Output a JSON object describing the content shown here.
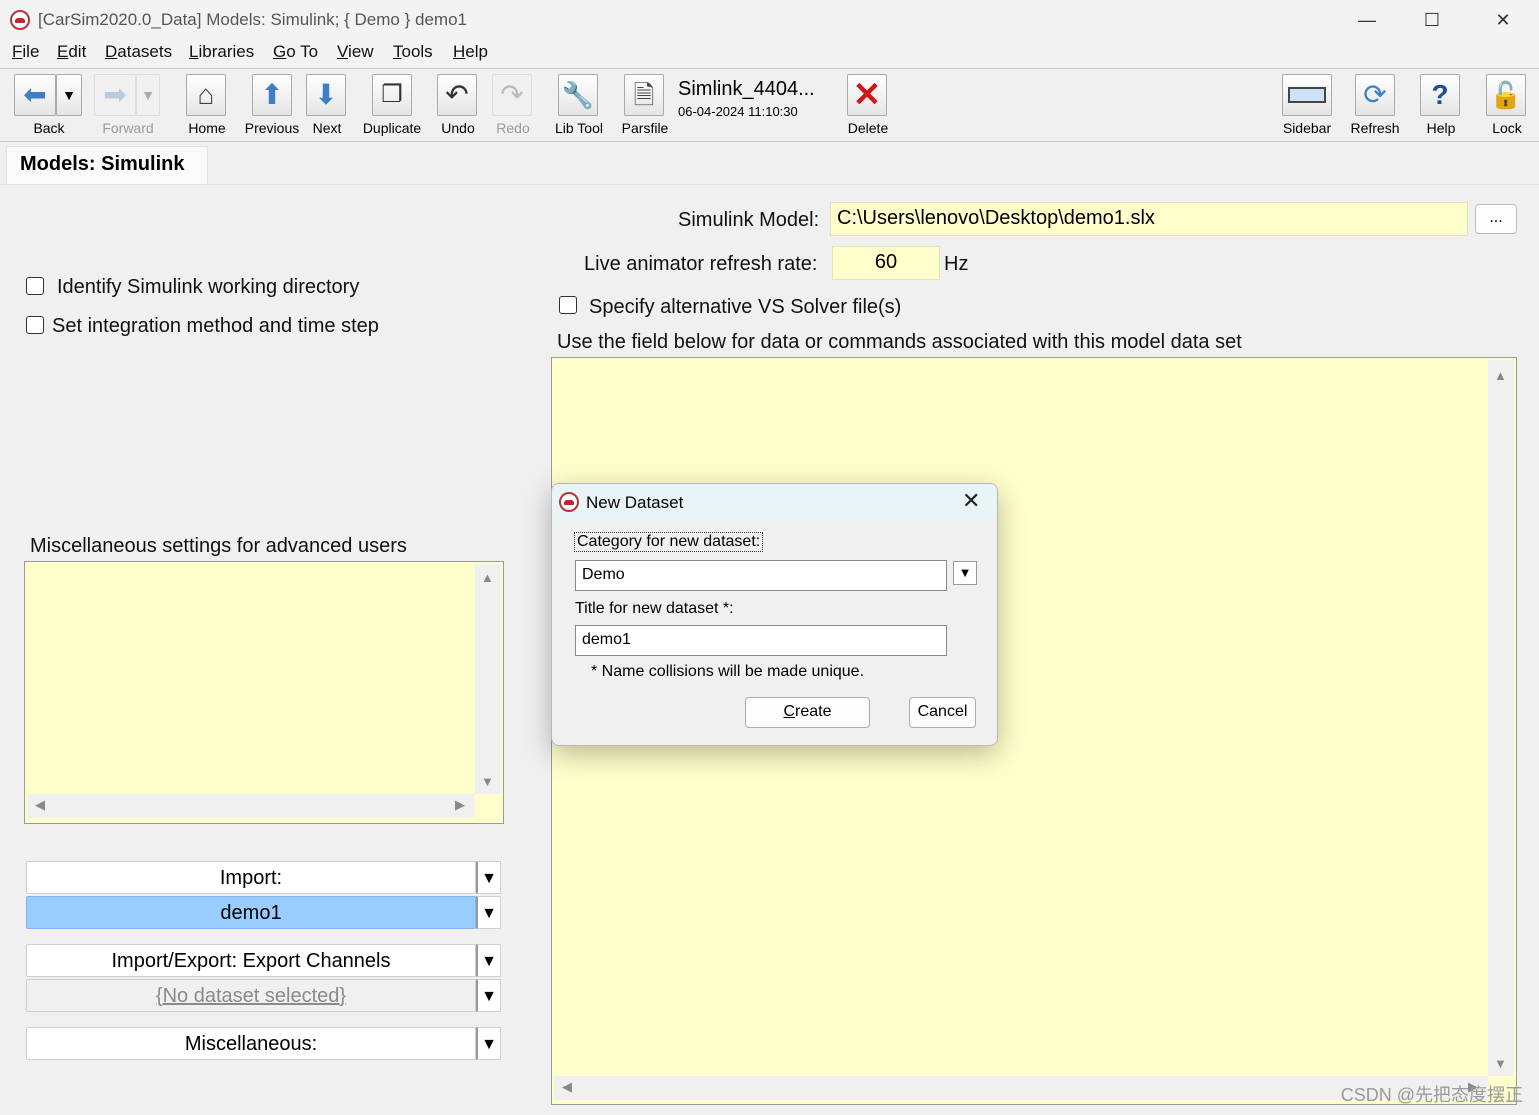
{
  "window": {
    "title": "[CarSim2020.0_Data] Models: Simulink; { Demo } demo1",
    "minimize_glyph": "—",
    "maximize_glyph": "☐",
    "close_glyph": "✕"
  },
  "menu": [
    {
      "key": "F",
      "rest": "ile"
    },
    {
      "key": "E",
      "rest": "dit"
    },
    {
      "key": "D",
      "rest": "atasets"
    },
    {
      "key": "L",
      "rest": "ibraries"
    },
    {
      "key": "G",
      "rest": "o To"
    },
    {
      "key": "V",
      "rest": "iew"
    },
    {
      "key": "T",
      "rest": "ools"
    },
    {
      "key": "H",
      "rest": "elp"
    }
  ],
  "toolbar": {
    "back": "Back",
    "forward": "Forward",
    "home": "Home",
    "previous": "Previous",
    "next": "Next",
    "duplicate": "Duplicate",
    "undo": "Undo",
    "redo": "Redo",
    "lib_tool": "Lib Tool",
    "parsfile": "Parsfile",
    "parsfile_title": "Simlink_4404...",
    "parsfile_date": "06-04-2024 11:10:30",
    "delete": "Delete",
    "sidebar": "Sidebar",
    "refresh": "Refresh",
    "help": "Help",
    "lock": "Lock"
  },
  "tab": {
    "label": "Models: Simulink"
  },
  "left": {
    "identify_dir_label": "Identify Simulink working directory",
    "integration_label": "Set integration method and time step",
    "misc_settings_label": "Miscellaneous settings for advanced users",
    "misc_settings_value": "",
    "import_label": "Import:",
    "import_value": "demo1",
    "export_label": "Import/Export: Export Channels",
    "export_value": "{No dataset selected}",
    "misc_label": "Miscellaneous:"
  },
  "right": {
    "simulink_model_label": "Simulink Model:",
    "simulink_model_value": "C:\\Users\\lenovo\\Desktop\\demo1.slx",
    "browse_label": "...",
    "refresh_rate_label": "Live animator refresh rate:",
    "refresh_rate_value": "60",
    "refresh_rate_unit": "Hz",
    "alt_solver_label": "Specify alternative VS Solver file(s)",
    "commands_label": "Use the field below  for data or commands associated with this model data set",
    "commands_value": ""
  },
  "dialog": {
    "title": "New Dataset",
    "category_label": "Category for new dataset:",
    "category_value": "Demo",
    "title_label": "Title for new dataset *:",
    "title_value": "demo1",
    "note": "* Name collisions will be made unique.",
    "create_key": "C",
    "create_rest": "reate",
    "cancel": "Cancel"
  },
  "colors": {
    "field_yellow": "#ffffcc",
    "selection_blue": "#99ccff",
    "delete_red": "#d01616",
    "icon_blue": "#3f7ec2"
  },
  "watermark": "CSDN @先把态度摆正"
}
